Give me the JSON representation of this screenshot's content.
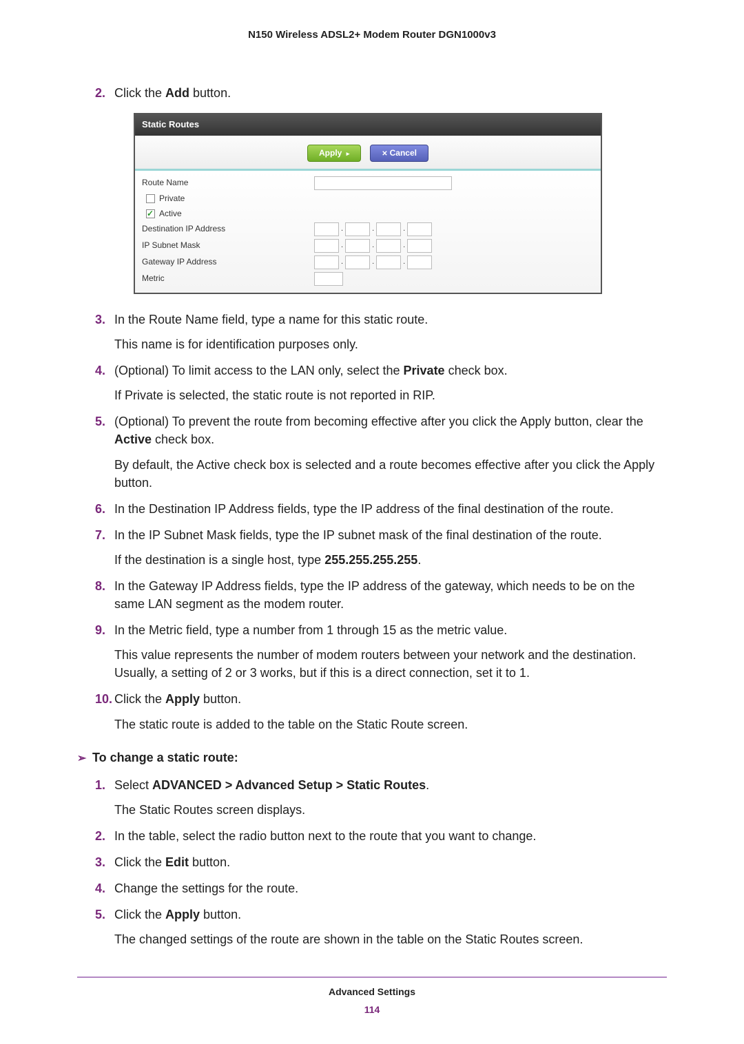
{
  "header": "N150 Wireless ADSL2+ Modem Router DGN1000v3",
  "stepsA": {
    "s2": {
      "num": "2.",
      "text_pre": "Click the ",
      "bold": "Add",
      "text_post": " button."
    },
    "s3": {
      "num": "3.",
      "line1": "In the Route Name field, type a name for this static route.",
      "line2": "This name is for identification purposes only."
    },
    "s4": {
      "num": "4.",
      "line1_pre": "(Optional) To limit access to the LAN only, select the ",
      "line1_bold": "Private",
      "line1_post": " check box.",
      "line2": "If Private is selected, the static route is not reported in RIP."
    },
    "s5": {
      "num": "5.",
      "line1_pre": "(Optional) To prevent the route from becoming effective after you click the Apply button, clear the ",
      "line1_bold": "Active",
      "line1_post": " check box.",
      "line2": "By default, the Active check box is selected and a route becomes effective after you click the Apply button."
    },
    "s6": {
      "num": "6.",
      "line1": "In the Destination IP Address fields, type the IP address of the final destination of the route."
    },
    "s7": {
      "num": "7.",
      "line1": "In the IP Subnet Mask fields, type the IP subnet mask of the final destination of the route.",
      "line2_pre": "If the destination is a single host, type ",
      "line2_bold": "255.255.255.255",
      "line2_post": "."
    },
    "s8": {
      "num": "8.",
      "line1": "In the Gateway IP Address fields, type the IP address of the gateway, which needs to be on the same LAN segment as the modem router."
    },
    "s9": {
      "num": "9.",
      "line1": "In the Metric field, type a number from 1 through 15 as the metric value.",
      "line2": "This value represents the number of modem routers between your network and the destination. Usually, a setting of 2 or 3 works, but if this is a direct connection, set it to 1."
    },
    "s10": {
      "num": "10.",
      "line1_pre": "Click the ",
      "line1_bold": "Apply",
      "line1_post": " button.",
      "line2": "The static route is added to the table on the Static Route screen."
    }
  },
  "procB_title": "To change a static route:",
  "stepsB": {
    "s1": {
      "num": "1.",
      "pre": "Select ",
      "bold": "ADVANCED > Advanced Setup > Static Routes",
      "post": ".",
      "line2": "The Static Routes screen displays."
    },
    "s2": {
      "num": "2.",
      "text": "In the table, select the radio button next to the route that you want to change."
    },
    "s3": {
      "num": "3.",
      "pre": "Click the ",
      "bold": "Edit",
      "post": " button."
    },
    "s4": {
      "num": "4.",
      "text": "Change the settings for the route."
    },
    "s5": {
      "num": "5.",
      "pre": "Click the ",
      "bold": "Apply",
      "post": " button.",
      "line2": "The changed settings of the route are shown in the table on the Static Routes screen."
    }
  },
  "ui": {
    "title": "Static Routes",
    "apply": "Apply",
    "cancel": "Cancel",
    "routeName": "Route Name",
    "private": "Private",
    "active": "Active",
    "destIP": "Destination IP Address",
    "subnet": "IP Subnet Mask",
    "gateway": "Gateway IP Address",
    "metric": "Metric"
  },
  "footer": {
    "section": "Advanced Settings",
    "page": "114"
  }
}
